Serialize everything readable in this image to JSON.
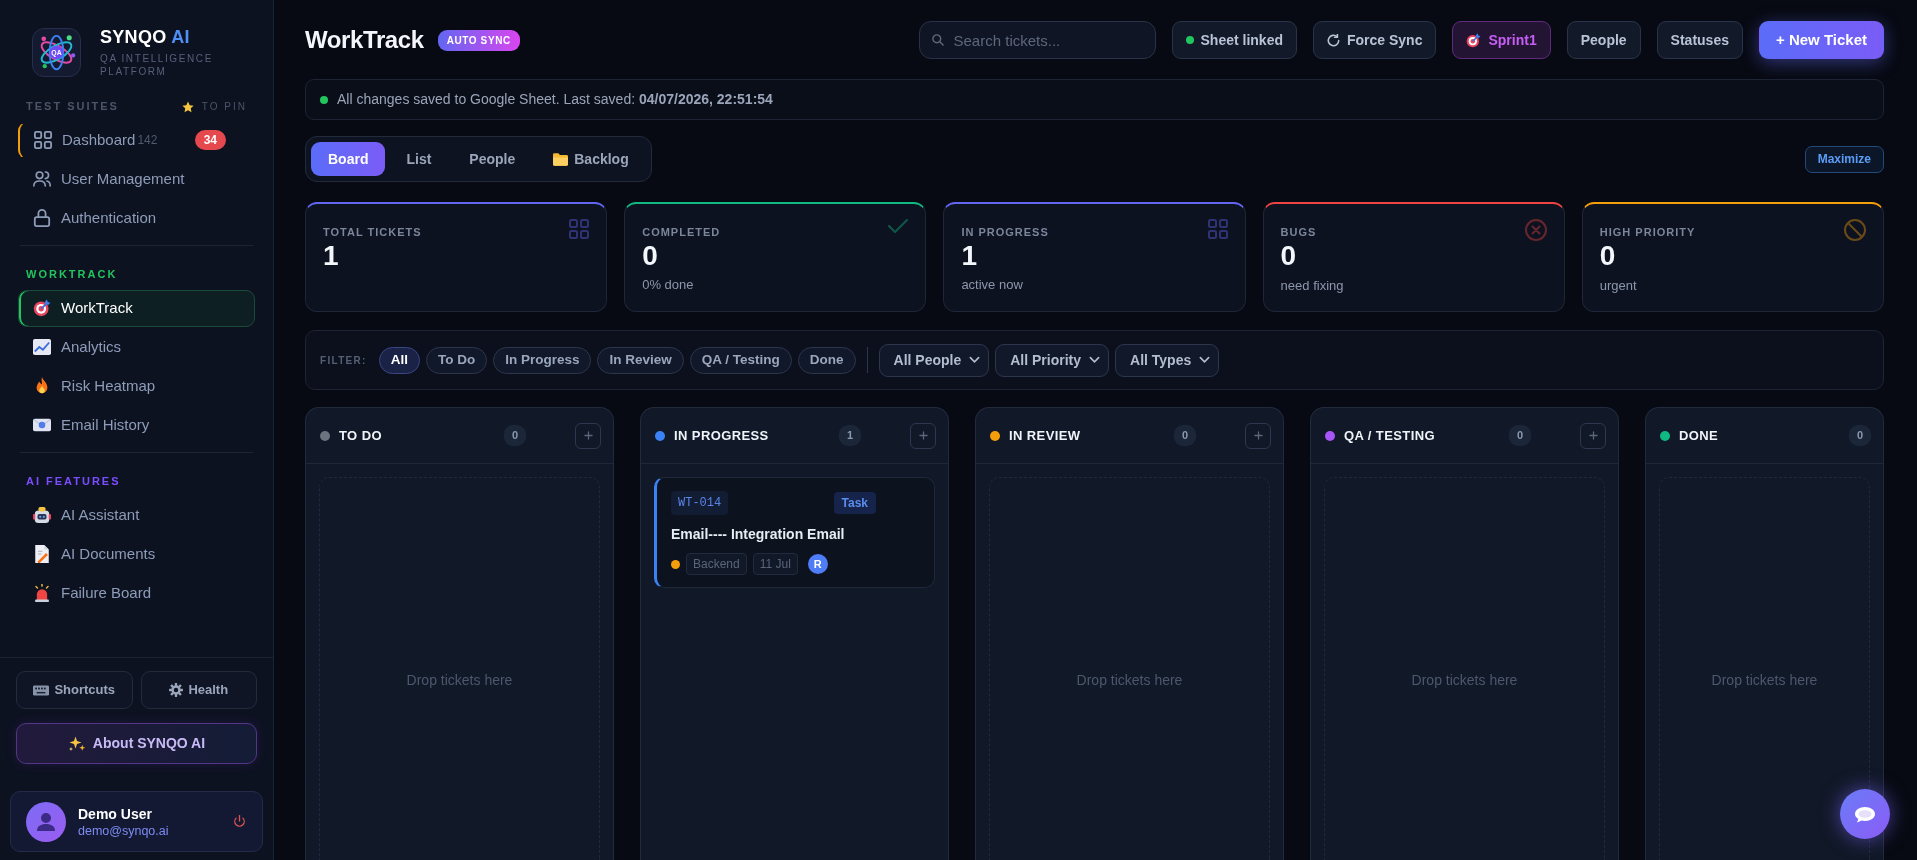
{
  "sidebar": {
    "brand": {
      "logo_text": "QA",
      "name": "SYNQO",
      "name_accent": "AI",
      "tagline": "QA INTELLIGENCE PLATFORM"
    },
    "sections": [
      {
        "label": "TEST SUITES",
        "color": "#4b5568",
        "hint": "TO PIN",
        "items": [
          {
            "label": "Dashboard",
            "count": "142",
            "badge": "34",
            "selected": false,
            "highlighted": true
          },
          {
            "label": "User Management",
            "selected": false,
            "highlighted": false
          },
          {
            "label": "Authentication",
            "selected": false,
            "highlighted": false
          }
        ]
      },
      {
        "label": "WORKTRACK",
        "color": "#22c55e",
        "items": [
          {
            "label": "WorkTrack",
            "selected": true,
            "highlighted": false
          },
          {
            "label": "Analytics",
            "selected": false,
            "highlighted": false
          },
          {
            "label": "Risk Heatmap",
            "selected": false,
            "highlighted": false
          },
          {
            "label": "Email History",
            "selected": false,
            "highlighted": false
          }
        ]
      },
      {
        "label": "AI FEATURES",
        "color": "#7c4dff",
        "items": [
          {
            "label": "AI Assistant",
            "selected": false,
            "highlighted": false
          },
          {
            "label": "AI Documents",
            "selected": false,
            "highlighted": false
          },
          {
            "label": "Failure Board",
            "selected": false,
            "highlighted": false
          }
        ]
      }
    ],
    "tools": [
      "Shortcuts",
      "Health"
    ],
    "about": "About SYNQO AI",
    "user": {
      "name": "Demo User",
      "email": "demo@synqo.ai"
    }
  },
  "header": {
    "title": "WorkTrack",
    "badge": "AUTO SYNC",
    "search": {
      "placeholder": "Search tickets..."
    },
    "actions": [
      {
        "label": "Sheet linked",
        "kind": "status"
      },
      {
        "label": "Force Sync",
        "kind": "sync"
      },
      {
        "label": "Sprint1",
        "kind": "sprint"
      },
      {
        "label": "People",
        "kind": "plain"
      },
      {
        "label": "Statuses",
        "kind": "plain"
      },
      {
        "label": "+ New Ticket",
        "kind": "primary"
      }
    ]
  },
  "save_banner": "All changes saved to Google Sheet. Last saved: **04/07/2026, 22:51:54**",
  "view_tabs": [
    {
      "label": "Board",
      "selected": true,
      "kind": "plain"
    },
    {
      "label": "List",
      "selected": false,
      "kind": "plain"
    },
    {
      "label": "People",
      "selected": false,
      "kind": "plain"
    },
    {
      "label": "Backlog",
      "selected": false,
      "kind": "folder"
    }
  ],
  "maximize": "Maximize",
  "stats": [
    {
      "label": "TOTAL TICKETS",
      "value": "1",
      "color": "#6366f1"
    },
    {
      "label": "COMPLETED",
      "value": "0",
      "sub": "0% done",
      "color": "#10b981"
    },
    {
      "label": "IN PROGRESS",
      "value": "1",
      "sub": "active now",
      "color": "#6366f1"
    },
    {
      "label": "BUGS",
      "value": "0",
      "sub": "need fixing",
      "color": "#ef4444"
    },
    {
      "label": "HIGH PRIORITY",
      "value": "0",
      "sub": "urgent",
      "color": "#f59e0b"
    }
  ],
  "filter": {
    "label": "FILTER:",
    "chips": [
      {
        "label": "All",
        "selected": true
      },
      {
        "label": "To Do",
        "selected": false
      },
      {
        "label": "In Progress",
        "selected": false
      },
      {
        "label": "In Review",
        "selected": false
      },
      {
        "label": "QA / Testing",
        "selected": false
      },
      {
        "label": "Done",
        "selected": false
      }
    ],
    "selects": [
      "All People",
      "All Priority",
      "All Types"
    ]
  },
  "columns": [
    {
      "title": "TO DO",
      "color": "#6b7280",
      "count": "0",
      "add_button": true,
      "empty_text": "Drop tickets here"
    },
    {
      "title": "IN PROGRESS",
      "color": "#3b82f6",
      "count": "1",
      "add_button": true,
      "tickets": [
        {
          "id": "WT-014",
          "type": "Task",
          "title": "Email---- Integration Email",
          "color": "#f59e0b",
          "tag": "Backend",
          "date": "11 Jul",
          "assignee": "R"
        }
      ]
    },
    {
      "title": "IN REVIEW",
      "color": "#f59e0b",
      "count": "0",
      "add_button": true,
      "empty_text": "Drop tickets here"
    },
    {
      "title": "QA / TESTING",
      "color": "#a855f7",
      "count": "0",
      "add_button": true,
      "empty_text": "Drop tickets here"
    },
    {
      "title": "DONE",
      "color": "#10b981",
      "count": "0",
      "add_button": false,
      "empty_text": "Drop tickets here"
    }
  ]
}
